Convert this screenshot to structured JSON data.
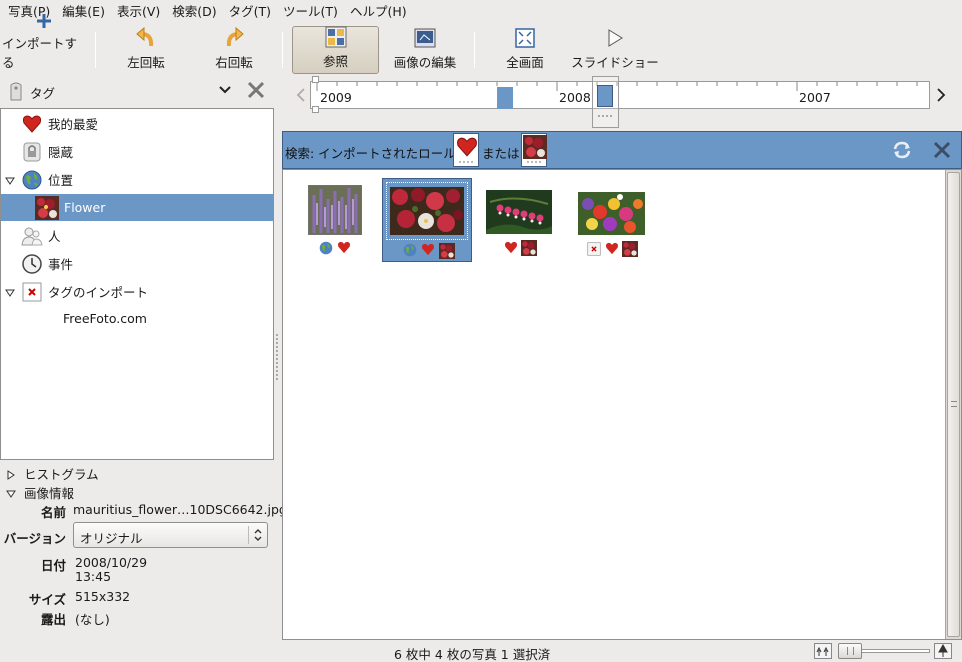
{
  "menubar": [
    "写真(P)",
    "編集(E)",
    "表示(V)",
    "検索(D)",
    "タグ(T)",
    "ツール(T)",
    "ヘルプ(H)"
  ],
  "toolbar": {
    "import": "インポートする",
    "rotate_left": "左回転",
    "rotate_right": "右回転",
    "browse": "参照",
    "edit_image": "画像の編集",
    "fullscreen": "全画面",
    "slideshow": "スライドショー"
  },
  "tag_selector": {
    "label": "タグ"
  },
  "tree": {
    "favorites": "我的最愛",
    "hidden": "隠蔵",
    "location": "位置",
    "flower": "Flower",
    "people": "人",
    "events": "事件",
    "import_tags": "タグのインポート",
    "freefoto": "FreeFoto.com"
  },
  "panels": {
    "histogram": "ヒストグラム",
    "image_info": "画像情報"
  },
  "info": {
    "name_label": "名前",
    "name_value": "mauritius_flower…10DSC6642.jpg",
    "version_label": "バージョン",
    "version_value": "オリジナル",
    "date_label": "日付",
    "date_value": "2008/10/29",
    "time_value": "13:45",
    "size_label": "サイズ",
    "size_value": "515x332",
    "exposure_label": "露出",
    "exposure_value": "(なし)"
  },
  "timeline": {
    "years": [
      "2009",
      "2008",
      "2007"
    ]
  },
  "search": {
    "prefix": "検索: インポートされたロール",
    "or": "または"
  },
  "status": {
    "text": "6 枚中 4 枚の写真 1 選択済"
  },
  "colors": {
    "selection": "#6b97c7",
    "accent_blue": "#3465a4"
  }
}
